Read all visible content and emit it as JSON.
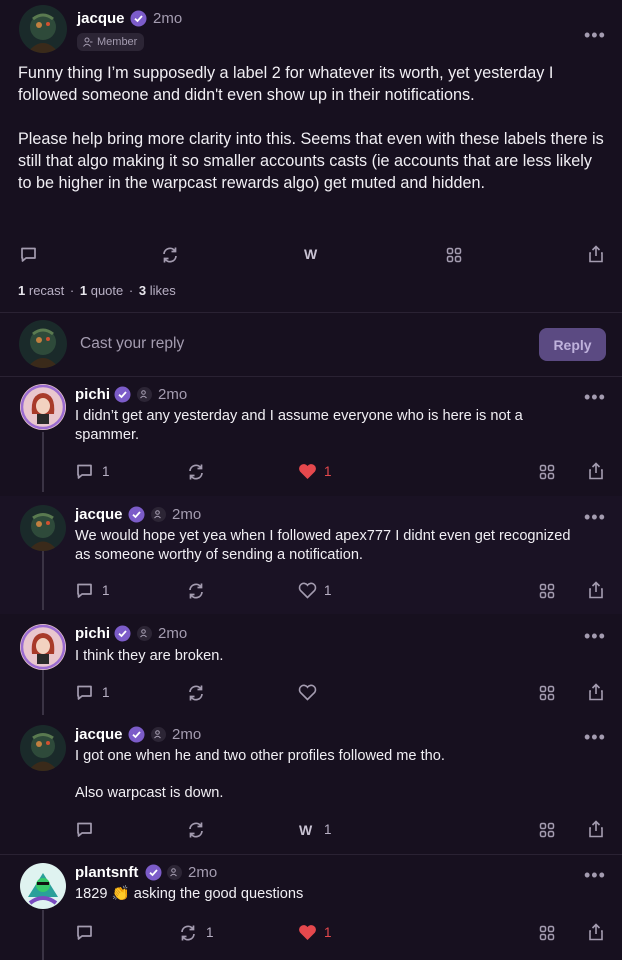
{
  "main_cast": {
    "author": "jacque",
    "time": "2mo",
    "role": "Member",
    "paragraph1": "Funny thing I’m supposedly a label 2 for whatever its worth, yet yesterday I followed someone and didn't even show up in their notifications.",
    "paragraph2": "Please help bring more clarity into this. Seems that even with these labels there is still that algo making it so smaller accounts casts (ie accounts that are less likely to be higher in the warpcast rewards algo) get muted and hidden.",
    "stats": {
      "recasts_n": "1",
      "recasts_label": "recast",
      "quotes_n": "1",
      "quotes_label": "quote",
      "likes_n": "3",
      "likes_label": "likes",
      "sep": "·"
    }
  },
  "composer": {
    "placeholder": "Cast your reply",
    "button": "Reply"
  },
  "replies": [
    {
      "author": "pichi",
      "time": "2mo",
      "text": "I didn’t get any yesterday and I assume everyone  who is here is not a spammer.",
      "comments": "1",
      "recasts": "",
      "likes": "1",
      "liked": true
    },
    {
      "author": "jacque",
      "time": "2mo",
      "text": "We would hope yet yea when I followed apex777 I didnt even get recognized as someone worthy of sending a notification.",
      "comments": "1",
      "recasts": "",
      "likes": "1",
      "liked": false
    },
    {
      "author": "pichi",
      "time": "2mo",
      "text": "I think they are broken.",
      "comments": "1",
      "recasts": "",
      "likes": "",
      "liked": false
    },
    {
      "author": "jacque",
      "time": "2mo",
      "text": "I got one when he and two other profiles followed me tho.",
      "text2": "Also warpcast is down.",
      "comments": "",
      "recasts": "",
      "w_count": "1"
    },
    {
      "author": "plantsnft",
      "time": "2mo",
      "text": "1829 👏 asking the good questions",
      "comments": "",
      "recasts": "1",
      "likes": "1",
      "liked": true
    }
  ],
  "icons": {
    "comment": "comment-icon",
    "recast": "recast-icon",
    "like": "heart-icon",
    "bookmark": "grid-icon",
    "share": "share-icon",
    "more": "more-icon",
    "verified": "verified-badge-icon",
    "member": "member-icon"
  },
  "colors": {
    "background": "#17101f",
    "accent": "#7c5cc9",
    "like": "#e5484d",
    "muted": "#a49cb0"
  },
  "w_mark": "W"
}
